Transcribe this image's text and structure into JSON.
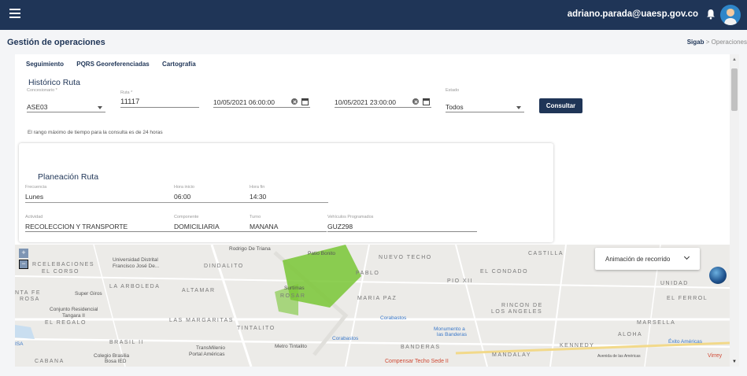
{
  "topbar": {
    "user_email": "adriano.parada@uaesp.gov.co",
    "icons": [
      "menu-icon",
      "bell-icon",
      "avatar"
    ]
  },
  "header": {
    "title": "Gestión de operaciones",
    "breadcrumb_root": "Sigab",
    "breadcrumb_sep": ">",
    "breadcrumb_current": "Operaciones"
  },
  "tabs": [
    "Seguimiento",
    "PQRS Georeferenciadas",
    "Cartografía"
  ],
  "historico": {
    "title": "Histórico Ruta",
    "concesionario_label": "Concesionario *",
    "concesionario_value": "ASE03",
    "ruta_label": "Ruta *",
    "ruta_value": "11117",
    "fecha_inicio": "10/05/2021 06:00:00",
    "fecha_fin": "10/05/2021 23:00:00",
    "estado_label": "Estado",
    "estado_value": "Todos",
    "consultar_label": "Consultar",
    "note": "El rango máximo de tiempo para la consulta es de 24 horas"
  },
  "planeacion": {
    "title": "Planeación Ruta",
    "frecuencia_label": "Frecuencia",
    "frecuencia_value": "Lunes",
    "hora_inicio_label": "Hora inicio",
    "hora_inicio_value": "06:00",
    "hora_fin_label": "Hora fin",
    "hora_fin_value": "14:30",
    "actividad_label": "Actividad",
    "actividad_value": "RECOLECCION Y TRANSPORTE",
    "componente_label": "Componente",
    "componente_value": "DOMICILIARIA",
    "turno_label": "Turno",
    "turno_value": "MANANA",
    "vehiculos_label": "Vehículos Programados",
    "vehiculos_value": "GUZ298"
  },
  "map": {
    "zoom_in": "+",
    "zoom_out": "−",
    "animation_select": "Animación de recorrido",
    "labels": {
      "rodrigo": "Rodrigo De Triana",
      "patio_bonito": "Patio Bonito",
      "nueva_techo": "NUEVO TECHO",
      "castilla": "CASTILLA",
      "univ": "Universidad Distrital",
      "univ2": "Francisco José De...",
      "dindalito": "DINDALITO",
      "celebraciones": "RCELEBACIONES",
      "corso": "EL CORSO",
      "pablo": "PABLO",
      "condado": "EL CONDADO",
      "pio": "PIO XII",
      "unidad": "UNIDAD",
      "arboleda": "LA ARBOLEDA",
      "altamar": "ALTAMAR",
      "rosario": "ROSAR",
      "maria_paz": "MARIA PAZ",
      "superg": "Super Giros",
      "santa_fe": "NTA FE",
      "rosa": "ROSA",
      "ferrol": "EL FERROL",
      "conjunto": "Conjunto Residencial",
      "tangara": "Tangara II",
      "regalo": "EL REGALO",
      "margaritas": "LAS MARGARITAS",
      "tintalito": "TINTALITO",
      "corabastos": "Corabastos",
      "corabastos2": "Corabastos",
      "rincon": "RINCON DE",
      "los_angeles": "LOS ANGELES",
      "marsella": "MARSELLA",
      "monumento": "Monumento a",
      "banderas_poi": "las Banderas",
      "alona": "ALOHA",
      "exito": "Éxito Américas",
      "brasil": "BRASIL II",
      "transmilenio": "TransMilenio",
      "portal": "Portal Américas",
      "metro": "Metro Tintalito",
      "banderas": "BANDERAS",
      "kennedy": "KENNEDY",
      "mandalay": "MANDALAY",
      "colegio": "Colegio Brasilia",
      "bosa_ied": "Bosa IED",
      "cabana": "CABANA",
      "compensar": "Compensar Techo Sede II",
      "virrey": "Virrey",
      "av_americas": "Avenida de las Américas",
      "sorteas": "Surtimas",
      "bosa_left": "ISA"
    }
  }
}
